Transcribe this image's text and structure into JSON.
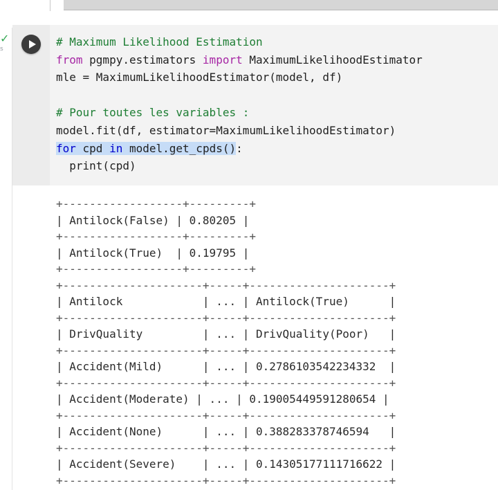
{
  "code_cell": {
    "status_icon": "check-icon",
    "run_icon": "play-icon",
    "lines": [
      {
        "segments": [
          {
            "text": "# Maximum Likelihood Estimation",
            "kind": "comment"
          }
        ]
      },
      {
        "segments": [
          {
            "text": "from",
            "kind": "kw"
          },
          {
            "text": " pgmpy.estimators ",
            "kind": "plain"
          },
          {
            "text": "import",
            "kind": "kw"
          },
          {
            "text": " MaximumLikelihoodEstimator",
            "kind": "plain"
          }
        ]
      },
      {
        "segments": [
          {
            "text": "mle = MaximumLikelihoodEstimator(model, df)",
            "kind": "plain"
          }
        ]
      },
      {
        "segments": [
          {
            "text": "",
            "kind": "plain"
          }
        ]
      },
      {
        "segments": [
          {
            "text": "# Pour toutes les variables :",
            "kind": "comment"
          }
        ]
      },
      {
        "segments": [
          {
            "text": "model.fit(df, estimator=MaximumLikelihoodEstimator)",
            "kind": "plain"
          }
        ]
      },
      {
        "segments": [
          {
            "text": "for",
            "kind": "kw2-sel"
          },
          {
            "text": " cpd ",
            "kind": "sel"
          },
          {
            "text": "in",
            "kind": "kw2-sel"
          },
          {
            "text": " model.get_cpds()",
            "kind": "sel"
          },
          {
            "text": ":",
            "kind": "plain"
          }
        ]
      },
      {
        "segments": [
          {
            "text": "  print(cpd)",
            "kind": "plain"
          }
        ]
      }
    ]
  },
  "output": {
    "lines": [
      "+------------------+---------+",
      "| Antilock(False) | 0.80205 |",
      "+------------------+---------+",
      "| Antilock(True)  | 0.19795 |",
      "+------------------+---------+",
      "+---------------------+-----+---------------------+",
      "| Antilock            | ... | Antilock(True)      |",
      "+---------------------+-----+---------------------+",
      "| DrivQuality         | ... | DrivQuality(Poor)   |",
      "+---------------------+-----+---------------------+",
      "| Accident(Mild)      | ... | 0.2786103542234332  |",
      "+---------------------+-----+---------------------+",
      "| Accident(Moderate) | ... | 0.19005449591280654 |",
      "+---------------------+-----+---------------------+",
      "| Accident(None)      | ... | 0.388283378746594   |",
      "+---------------------+-----+---------------------+",
      "| Accident(Severe)    | ... | 0.14305177111716622 |",
      "+---------------------+-----+---------------------+"
    ]
  }
}
